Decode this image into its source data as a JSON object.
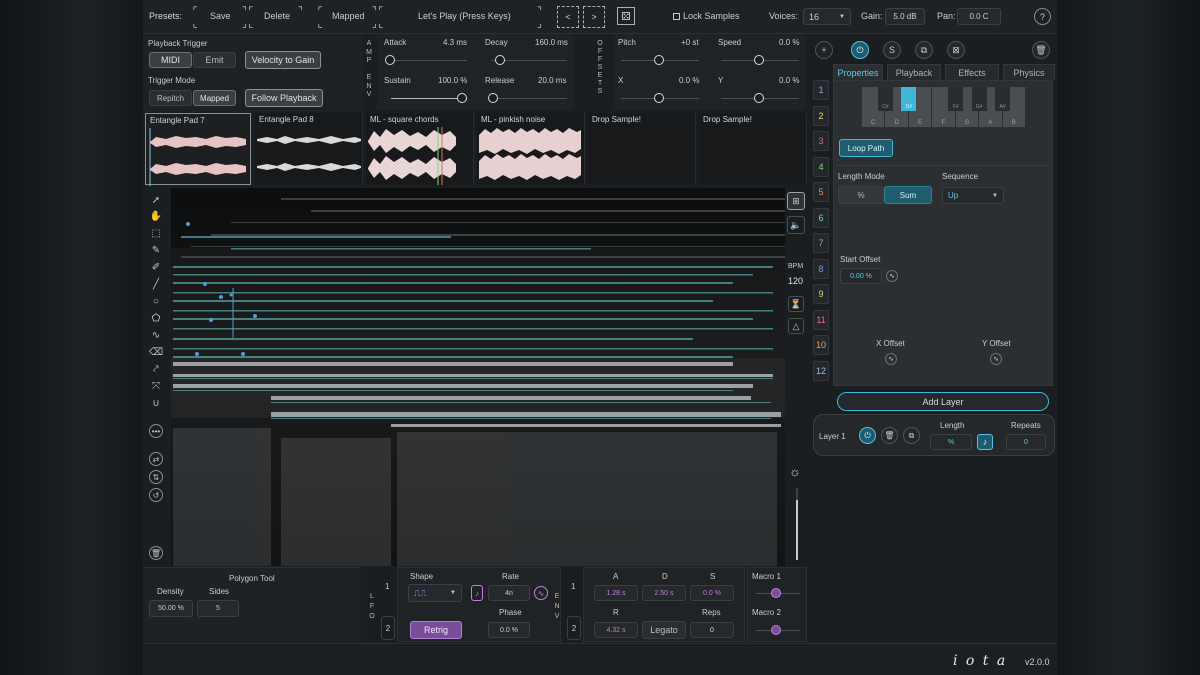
{
  "topbar": {
    "presets_label": "Presets:",
    "save": "Save",
    "delete": "Delete",
    "mapped": "Mapped",
    "lets_play": "Let's Play (Press Keys)",
    "lock_samples": "Lock Samples",
    "voices_label": "Voices:",
    "voices_value": "16",
    "gain_label": "Gain:",
    "gain_value": "5.0 dB",
    "pan_label": "Pan:",
    "pan_value": "0.0 C",
    "help": "?"
  },
  "trigger": {
    "playback_trigger": "Playback Trigger",
    "midi": "MIDI",
    "emit": "Emit",
    "velocity_to_gain": "Velocity to Gain",
    "trigger_mode": "Trigger Mode",
    "repitch": "Repitch",
    "mapped": "Mapped",
    "follow_playback": "Follow Playback"
  },
  "amp_env": {
    "side_label": "AMP ENV",
    "attack_label": "Attack",
    "attack_value": "4.3 ms",
    "decay_label": "Decay",
    "decay_value": "160.0 ms",
    "sustain_label": "Sustain",
    "sustain_value": "100.0 %",
    "release_label": "Release",
    "release_value": "20.0 ms"
  },
  "offsets": {
    "side_label": "OFFSETS",
    "pitch_label": "Pitch",
    "pitch_value": "+0 st",
    "speed_label": "Speed",
    "speed_value": "0.0 %",
    "x_label": "X",
    "x_value": "0.0 %",
    "y_label": "Y",
    "y_value": "0.0 %"
  },
  "samples": [
    {
      "name": "Entangle Pad 7"
    },
    {
      "name": "Entangle Pad 8"
    },
    {
      "name": "ML - square chords"
    },
    {
      "name": "ML - pinkish noise"
    },
    {
      "name": "Drop Sample!"
    },
    {
      "name": "Drop Sample!"
    }
  ],
  "spectro": {
    "bpm_label": "BPM",
    "bpm_value": "120"
  },
  "layer_numbers": [
    "1",
    "2",
    "3",
    "4",
    "5",
    "6",
    "7",
    "8",
    "9",
    "11",
    "10",
    "12"
  ],
  "layer_colors": [
    "#6fa8dc",
    "#e6d36b",
    "#e06b6b",
    "#7bd67b",
    "#e08a4f",
    "#6fd0d8",
    "#c07fe0",
    "#6f9be0",
    "#d6d66b",
    "#e06b8a",
    "#e0a06b",
    "#9bb7e0"
  ],
  "right_panel": {
    "tabs": [
      "Properties",
      "Playback",
      "Effects",
      "Physics"
    ],
    "keys": [
      "C",
      "D",
      "E",
      "F",
      "G",
      "A",
      "B"
    ],
    "black_keys": [
      "C#",
      "D#",
      "F#",
      "G#",
      "A#"
    ],
    "loop_path": "Loop Path",
    "length_mode_label": "Length Mode",
    "length_mode_pct": "%",
    "length_mode_sum": "Sum",
    "sequence_label": "Sequence",
    "sequence_value": "Up",
    "start_offset_label": "Start Offset",
    "start_offset_value": "0.00 %",
    "x_offset_label": "X Offset",
    "y_offset_label": "Y Offset",
    "add_layer": "Add Layer",
    "layer1_label": "Layer 1",
    "length_label": "Length",
    "length_value": "%",
    "repeats_label": "Repeats",
    "repeats_value": "0"
  },
  "polygon_tool": {
    "title": "Polygon Tool",
    "density_label": "Density",
    "density_value": "50.00 %",
    "sides_label": "Sides",
    "sides_value": "5"
  },
  "lfo": {
    "side_label": "LFO",
    "shape_label": "Shape",
    "rate_label": "Rate",
    "rate_value": "4n",
    "phase_label": "Phase",
    "phase_value": "0.0 %",
    "retrig": "Retrig",
    "slot1": "1",
    "slot2": "2"
  },
  "env2": {
    "side_label": "ENV",
    "a_label": "A",
    "a_value": "1.28 s",
    "d_label": "D",
    "d_value": "2.50 s",
    "s_label": "S",
    "s_value": "0.0 %",
    "r_label": "R",
    "r_value": "4.32 s",
    "legato": "Legato",
    "reps_label": "Reps",
    "reps_value": "0",
    "slot1": "1",
    "slot2": "2"
  },
  "macros": {
    "macro1": "Macro 1",
    "macro2": "Macro 2"
  },
  "footer": {
    "logo": "i o t a",
    "version": "v2.0.0"
  }
}
